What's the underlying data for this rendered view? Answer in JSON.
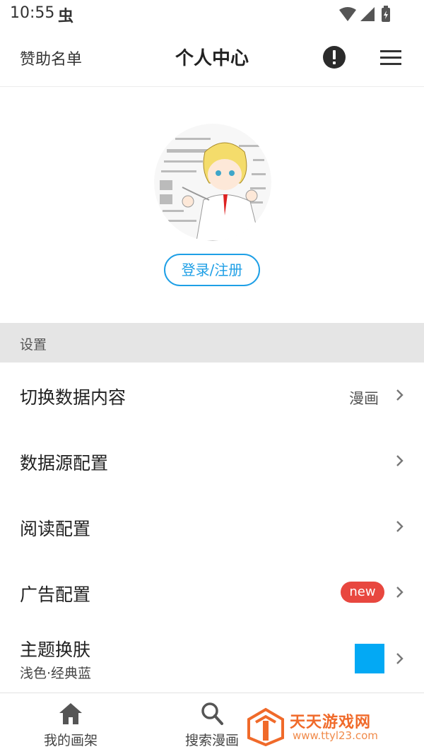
{
  "status_bar": {
    "time": "10:55",
    "app_glyph": "虫"
  },
  "header": {
    "sponsor_label": "赞助名单",
    "title": "个人中心",
    "alert_icon": "alert-icon",
    "menu_icon": "menu-icon"
  },
  "profile": {
    "login_label": "登录/注册"
  },
  "settings": {
    "section_title": "设置",
    "items": [
      {
        "label": "切换数据内容",
        "value": "漫画"
      },
      {
        "label": "数据源配置"
      },
      {
        "label": "阅读配置"
      },
      {
        "label": "广告配置",
        "badge": "new"
      },
      {
        "label": "主题换肤",
        "subtitle": "浅色·经典蓝",
        "swatch_color": "#03A9F4"
      }
    ]
  },
  "bottom_nav": {
    "items": [
      {
        "label": "我的画架",
        "icon": "home-icon"
      },
      {
        "label": "搜索漫画",
        "icon": "search-icon"
      }
    ]
  },
  "watermark": {
    "name": "天天游戏网",
    "url": "www.ttyl23.com"
  },
  "colors": {
    "accent": "#1E9FE6",
    "badge": "#E8473F",
    "theme_swatch": "#03A9F4"
  }
}
